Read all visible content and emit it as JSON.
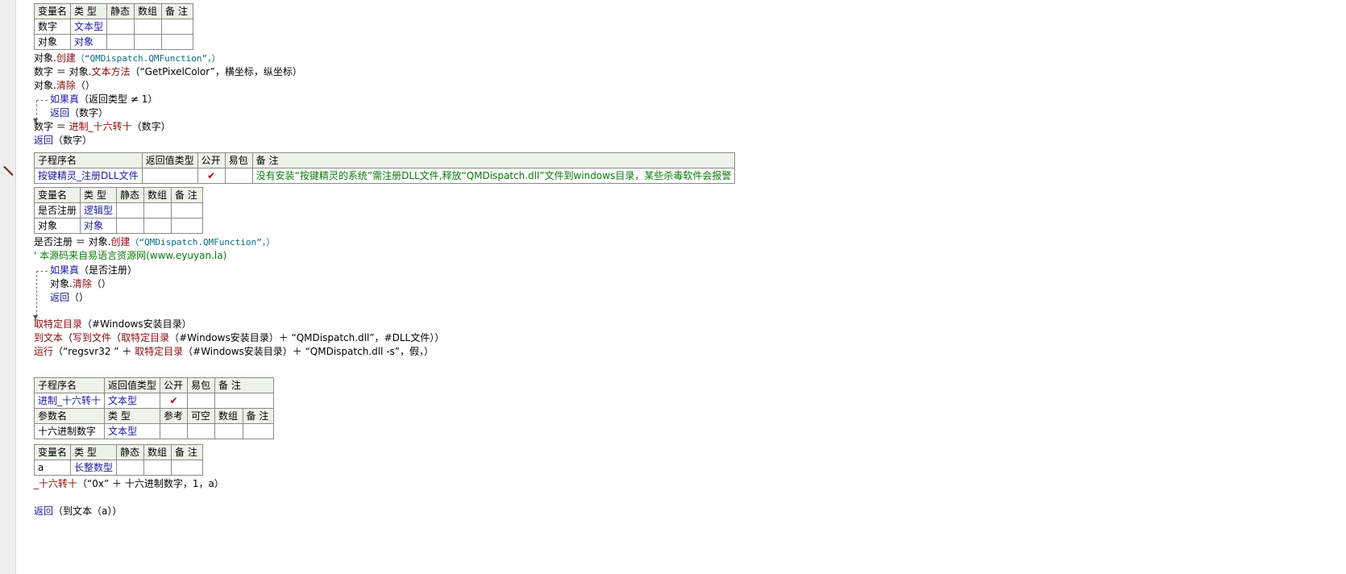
{
  "var_table_headers": [
    "变量名",
    "类 型",
    "静态",
    "数组",
    "备 注"
  ],
  "sub_table_headers": [
    "子程序名",
    "返回值类型",
    "公开",
    "易包",
    "备 注"
  ],
  "param_table_headers": [
    "参数名",
    "类 型",
    "参考",
    "可空",
    "数组",
    "备 注"
  ],
  "check_mark": "✔",
  "block1": {
    "vars": [
      {
        "name": "数字",
        "type": "文本型"
      },
      {
        "name": "对象",
        "type": "对象"
      }
    ],
    "lines": {
      "l1_obj": "对象.",
      "l1_fn": "创建",
      "l1_args": "（“QMDispatch.QMFunction”，）",
      "l2_a": "数字 ＝ 对象.",
      "l2_fn": "文本方法",
      "l2_args": "（“GetPixelColor”，横坐标，纵坐标）",
      "l3_obj": "对象.",
      "l3_fn": "清除",
      "l3_args": "（）",
      "l4_kw": "如果真",
      "l4_args": "（返回类型 ≠ 1）",
      "l5_kw": "返回",
      "l5_args": "（数字）",
      "l6_a": "数字 ＝ ",
      "l6_fn": "进制_十六转十",
      "l6_args": "（数字）",
      "l7_kw": "返回",
      "l7_args": "（数字）"
    }
  },
  "block2": {
    "sub": {
      "name": "按键精灵_注册DLL文件",
      "remark": "没有安装“按键精灵的系统”需注册DLL文件,释放“QMDispatch.dll”文件到windows目录，某些杀毒软件会报警"
    },
    "vars": [
      {
        "name": "是否注册",
        "type": "逻辑型"
      },
      {
        "name": "对象",
        "type": "对象"
      }
    ],
    "lines": {
      "l1_a": "是否注册 ＝ 对象.",
      "l1_fn": "创建",
      "l1_args": "（“QMDispatch.QMFunction”，）",
      "l2_cmt": "' 本源码来自易语言资源网(www.eyuyan.la)",
      "l3_kw": "如果真",
      "l3_args": "（是否注册）",
      "l4_obj": "对象.",
      "l4_fn": "清除",
      "l4_args": "（）",
      "l5_kw": "返回",
      "l5_args": "（）",
      "l6_fn": "取特定目录",
      "l6_args": "（#Windows安装目录）",
      "l7_fn1": "到文本",
      "l7_p1": "（",
      "l7_fn2": "写到文件",
      "l7_p2": "（",
      "l7_fn3": "取特定目录",
      "l7_args": "（#Windows安装目录）＋ “QMDispatch.dll”，#DLL文件））",
      "l8_fn1": "运行",
      "l8_a": "（“regsvr32 ” ＋ ",
      "l8_fn2": "取特定目录",
      "l8_args": "（#Windows安装目录）＋ “QMDispatch.dll -s”，假，）"
    }
  },
  "block3": {
    "sub": {
      "name": "进制_十六转十",
      "return_type": "文本型"
    },
    "param": {
      "name": "十六进制数字",
      "type": "文本型"
    },
    "vars": [
      {
        "name": "a",
        "type": "长整数型"
      }
    ],
    "lines": {
      "l1_fn": "_十六转十",
      "l1_args": "（“0x” ＋ 十六进制数字，1，a）",
      "l2_kw": "返回",
      "l2_args": "（到文本（a））"
    }
  }
}
